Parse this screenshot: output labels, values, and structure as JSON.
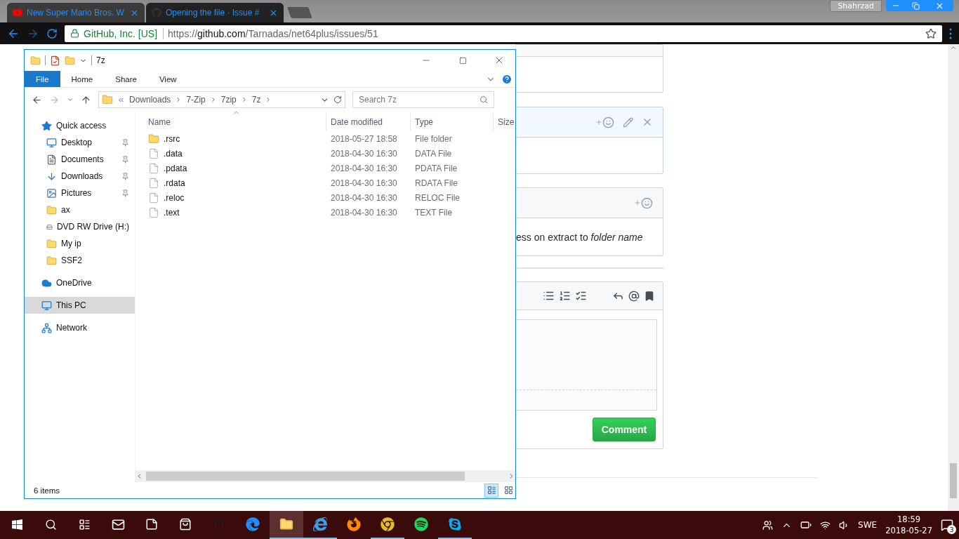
{
  "browser": {
    "tabs": [
      {
        "title": "New Super Mario Bros. W",
        "selected": false
      },
      {
        "title": "Opening the file · Issue #",
        "selected": true
      }
    ],
    "profile": "Shahrzad",
    "address": {
      "site": "GitHub, Inc. [US]",
      "url_scheme": "https://",
      "url_host": "github.com",
      "url_path": "/Tarnadas/net64plus/issues/51"
    }
  },
  "page": {
    "comment_text": "ess on extract to *folder name*",
    "comment_button": "Comment"
  },
  "explorer": {
    "title": "7z",
    "ribbon_tabs": [
      {
        "label": "File",
        "selected": true
      },
      {
        "label": "Home",
        "selected": false
      },
      {
        "label": "Share",
        "selected": false
      },
      {
        "label": "View",
        "selected": false
      }
    ],
    "breadcrumb": [
      "Downloads",
      "7-Zip",
      "7zip",
      "7z"
    ],
    "search": {
      "placeholder": "Search 7z"
    },
    "columns": [
      "Name",
      "Date modified",
      "Type",
      "Size"
    ],
    "nav": [
      {
        "label": "Quick access",
        "kind": "star",
        "selected": false,
        "children": [
          {
            "label": "Desktop",
            "kind": "desktop",
            "pinned": true,
            "selected": false
          },
          {
            "label": "Documents",
            "kind": "documents",
            "pinned": true,
            "selected": false
          },
          {
            "label": "Downloads",
            "kind": "downloads",
            "pinned": true,
            "selected": false
          },
          {
            "label": "Pictures",
            "kind": "pictures",
            "pinned": true,
            "selected": false
          },
          {
            "label": "ax",
            "kind": "folder",
            "pinned": false,
            "selected": false
          },
          {
            "label": "DVD RW Drive (H:)",
            "kind": "drive",
            "pinned": false,
            "selected": false
          },
          {
            "label": "My ip",
            "kind": "folder",
            "pinned": false,
            "selected": false
          },
          {
            "label": "SSF2",
            "kind": "folder",
            "pinned": false,
            "selected": false
          }
        ]
      },
      {
        "label": "OneDrive",
        "kind": "cloud",
        "selected": false
      },
      {
        "label": "This PC",
        "kind": "pc",
        "selected": true
      },
      {
        "label": "Network",
        "kind": "network",
        "selected": false
      }
    ],
    "files": [
      {
        "name": ".rsrc",
        "date": "2018-05-27 18:58",
        "type": "File folder",
        "kind": "folder"
      },
      {
        "name": ".data",
        "date": "2018-04-30 16:30",
        "type": "DATA File",
        "kind": "file"
      },
      {
        "name": ".pdata",
        "date": "2018-04-30 16:30",
        "type": "PDATA File",
        "kind": "file"
      },
      {
        "name": ".rdata",
        "date": "2018-04-30 16:30",
        "type": "RDATA File",
        "kind": "file"
      },
      {
        "name": ".reloc",
        "date": "2018-04-30 16:30",
        "type": "RELOC File",
        "kind": "file"
      },
      {
        "name": ".text",
        "date": "2018-04-30 16:30",
        "type": "TEXT File",
        "kind": "file"
      }
    ],
    "status": "6 items"
  },
  "taskbar": {
    "language": "SWE",
    "time": "18:59",
    "date": "2018-05-27",
    "notifications": "3"
  }
}
